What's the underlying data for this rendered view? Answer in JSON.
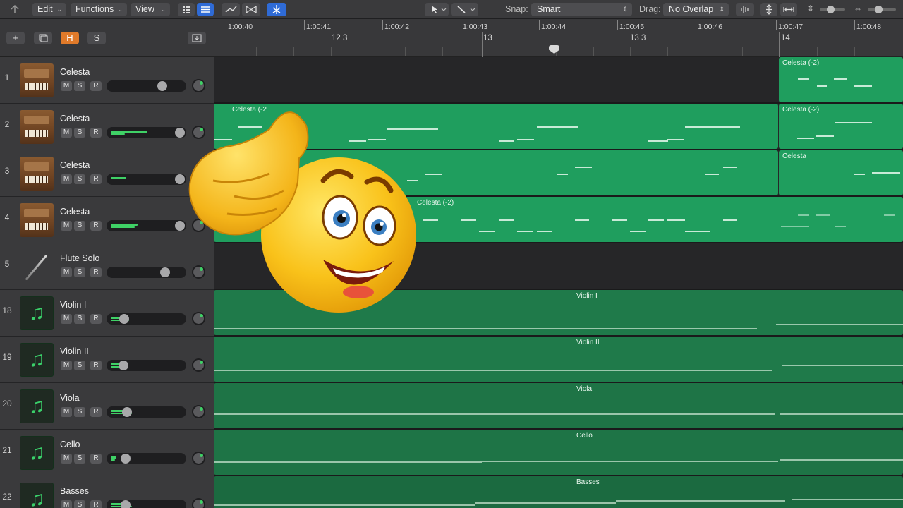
{
  "toolbar": {
    "edit": "Edit",
    "functions": "Functions",
    "view": "View",
    "snap_label": "Snap:",
    "snap_value": "Smart",
    "drag_label": "Drag:",
    "drag_value": "No Overlap"
  },
  "header_toolbar": {
    "add": "+",
    "h": "H",
    "s": "S"
  },
  "ruler": {
    "timecodes": [
      "1:00:40",
      "1:00:41",
      "1:00:42",
      "1:00:43",
      "1:00:44",
      "1:00:45",
      "1:00:46",
      "1:00:47",
      "1:00:48"
    ],
    "bars": [
      "12 3",
      "13",
      "13 3",
      "14"
    ]
  },
  "tracks": [
    {
      "num": "1",
      "name": "Celesta",
      "icon": "piano-icon"
    },
    {
      "num": "2",
      "name": "Celesta",
      "icon": "piano-icon"
    },
    {
      "num": "3",
      "name": "Celesta",
      "icon": "piano-icon"
    },
    {
      "num": "4",
      "name": "Celesta",
      "icon": "piano-icon"
    },
    {
      "num": "5",
      "name": "Flute Solo",
      "icon": "flute-icon"
    },
    {
      "num": "18",
      "name": "Violin I",
      "icon": "music-note-icon"
    },
    {
      "num": "19",
      "name": "Violin II",
      "icon": "music-note-icon"
    },
    {
      "num": "20",
      "name": "Viola",
      "icon": "music-note-icon"
    },
    {
      "num": "21",
      "name": "Cello",
      "icon": "music-note-icon"
    },
    {
      "num": "22",
      "name": "Basses",
      "icon": "music-note-icon"
    }
  ],
  "track_buttons": {
    "m": "M",
    "s": "S",
    "r": "R"
  },
  "regions": {
    "r1": "Celesta (-2)",
    "r2a": "Celesta (-2",
    "r2b": "Celesta (-2)",
    "r3": "Celesta",
    "r4": "Celesta (-2)",
    "violin1": "Violin I",
    "violin2": "Violin II",
    "viola": "Viola",
    "cello": "Cello",
    "basses": "Basses"
  },
  "colors": {
    "region_bright": "#1f9e5e",
    "region_dark": "#1f7a4a",
    "accent_blue": "#2f6bd6",
    "accent_orange": "#e07a2a"
  }
}
